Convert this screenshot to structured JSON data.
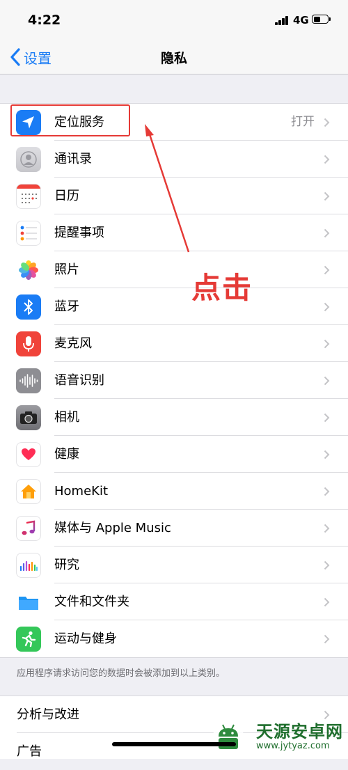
{
  "status": {
    "time": "4:22",
    "network": "4G"
  },
  "nav": {
    "back_label": "设置",
    "title": "隐私"
  },
  "privacy_items": [
    {
      "label": "定位服务",
      "value": "打开",
      "icon": "location-arrow-icon",
      "color": "#1a7cf5"
    },
    {
      "label": "通讯录",
      "value": "",
      "icon": "contacts-icon",
      "color": "#c8c8cc"
    },
    {
      "label": "日历",
      "value": "",
      "icon": "calendar-icon",
      "color": "#ffffff"
    },
    {
      "label": "提醒事项",
      "value": "",
      "icon": "reminders-icon",
      "color": "#ffffff"
    },
    {
      "label": "照片",
      "value": "",
      "icon": "photos-icon",
      "color": "#ffffff"
    },
    {
      "label": "蓝牙",
      "value": "",
      "icon": "bluetooth-icon",
      "color": "#1a7cf5"
    },
    {
      "label": "麦克风",
      "value": "",
      "icon": "microphone-icon",
      "color": "#f0433a"
    },
    {
      "label": "语音识别",
      "value": "",
      "icon": "speech-recognition-icon",
      "color": "#8e8e93"
    },
    {
      "label": "相机",
      "value": "",
      "icon": "camera-icon",
      "color": "#8e8e93"
    },
    {
      "label": "健康",
      "value": "",
      "icon": "health-heart-icon",
      "color": "#ffffff"
    },
    {
      "label": "HomeKit",
      "value": "",
      "icon": "homekit-house-icon",
      "color": "#ffffff"
    },
    {
      "label": "媒体与 Apple Music",
      "value": "",
      "icon": "music-note-icon",
      "color": "#ffffff"
    },
    {
      "label": "研究",
      "value": "",
      "icon": "research-bars-icon",
      "color": "#ffffff"
    },
    {
      "label": "文件和文件夹",
      "value": "",
      "icon": "folder-icon",
      "color": "#1f96f3"
    },
    {
      "label": "运动与健身",
      "value": "",
      "icon": "fitness-runner-icon",
      "color": "#34c759"
    }
  ],
  "footer_note": "应用程序请求访问您的数据时会被添加到以上类别。",
  "other_items": [
    {
      "label": "分析与改进"
    },
    {
      "label": "广告"
    }
  ],
  "annotation": {
    "text": "点击",
    "color": "#e53a36"
  },
  "watermark": {
    "name": "天源安卓网",
    "url": "www.jytyaz.com"
  }
}
